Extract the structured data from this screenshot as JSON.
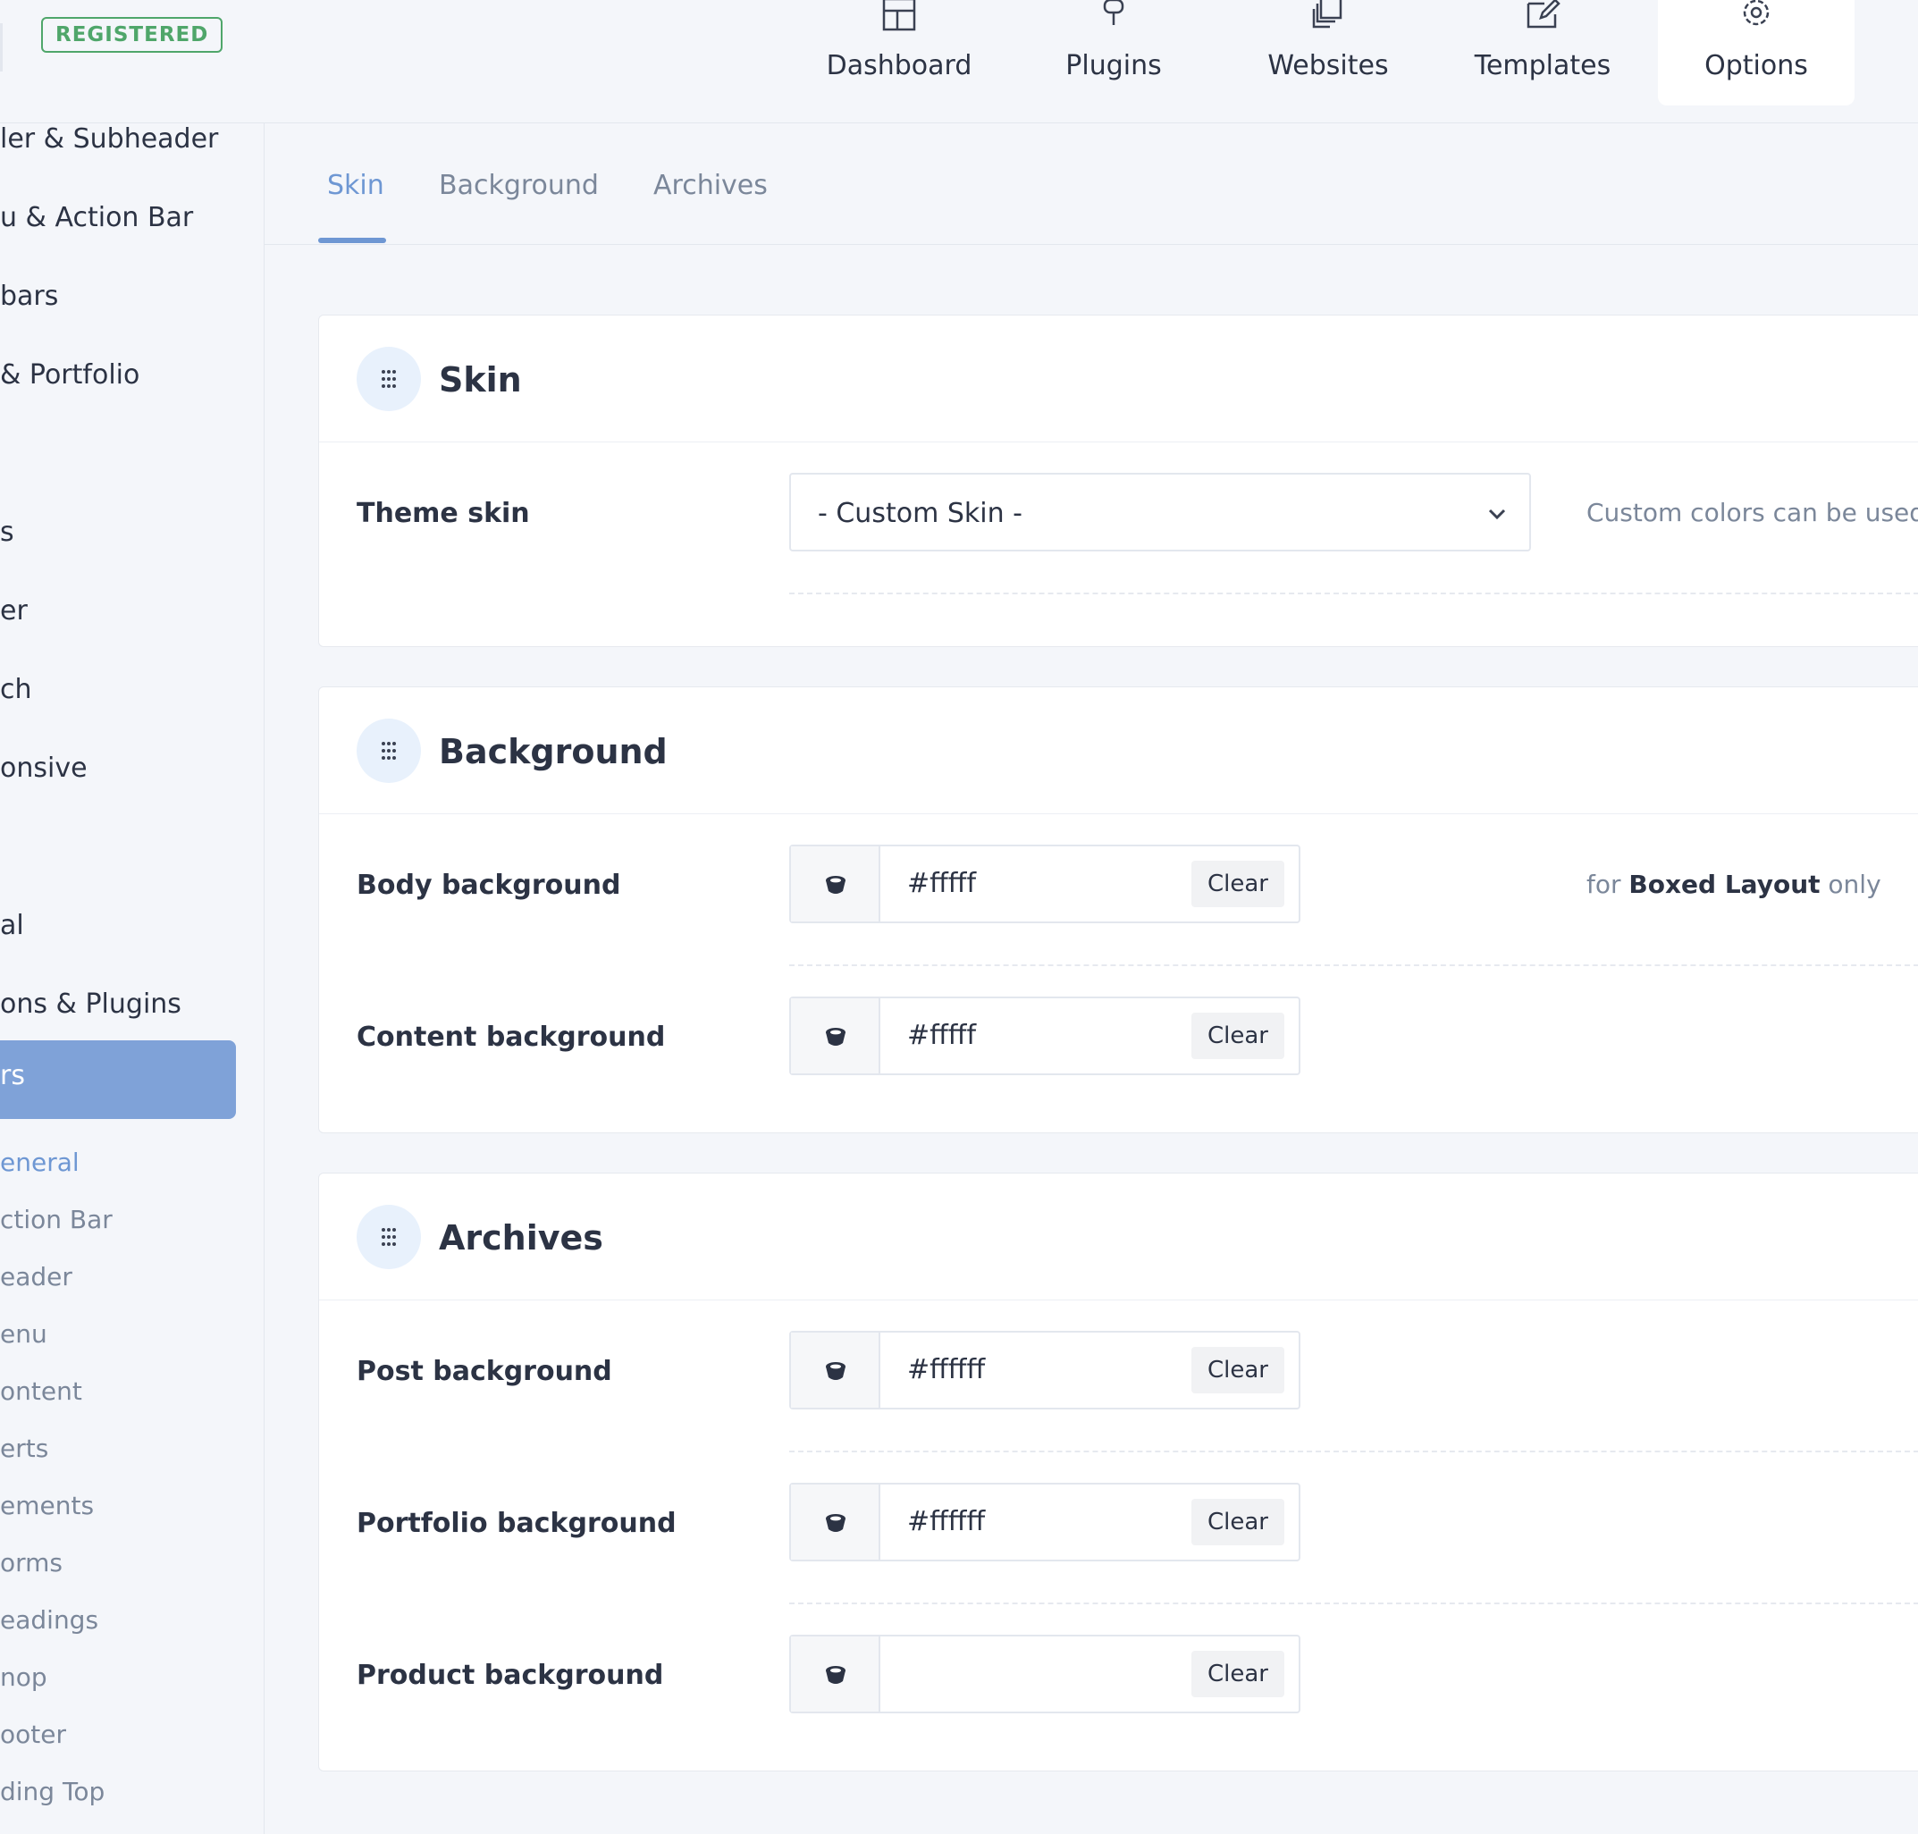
{
  "header": {
    "badge": "REGISTERED",
    "nav": [
      {
        "label": "Dashboard",
        "icon": "dashboard-icon"
      },
      {
        "label": "Plugins",
        "icon": "plug-icon"
      },
      {
        "label": "Websites",
        "icon": "websites-icon"
      },
      {
        "label": "Templates",
        "icon": "templates-icon"
      },
      {
        "label": "Options",
        "icon": "gear-icon",
        "active": true
      }
    ]
  },
  "sidebar": {
    "items": [
      "ler & Subheader",
      "u & Action Bar",
      "bars",
      "& Portfolio",
      "s",
      "er",
      "ch",
      "onsive",
      "al",
      "ons & Plugins"
    ],
    "active_item": "rs",
    "sub_items": [
      "eneral",
      "ction Bar",
      "eader",
      "enu",
      "ontent",
      "erts",
      "ements",
      "orms",
      "eadings",
      "nop",
      "ooter",
      "ding Top"
    ]
  },
  "tabs": [
    "Skin",
    "Background",
    "Archives"
  ],
  "skin": {
    "title": "Skin",
    "theme_skin_label": "Theme skin",
    "theme_skin_value": "- Custom Skin -",
    "hint": "Custom colors can be used w"
  },
  "background": {
    "title": "Background",
    "body_label": "Body background",
    "body_value": "#fffff",
    "body_hint_pre": "for",
    "body_hint_bold": "Boxed Layout",
    "body_hint_post": "only",
    "content_label": "Content background",
    "content_value": "#fffff"
  },
  "archives": {
    "title": "Archives",
    "post_label": "Post background",
    "post_value": "#ffffff",
    "portfolio_label": "Portfolio background",
    "portfolio_value": "#ffffff",
    "product_label": "Product background",
    "product_value": ""
  },
  "clear_label": "Clear",
  "colors": {
    "accent": "#6e97d3",
    "active_sidebar": "#7fa2d8",
    "badge": "#4fa66a"
  }
}
